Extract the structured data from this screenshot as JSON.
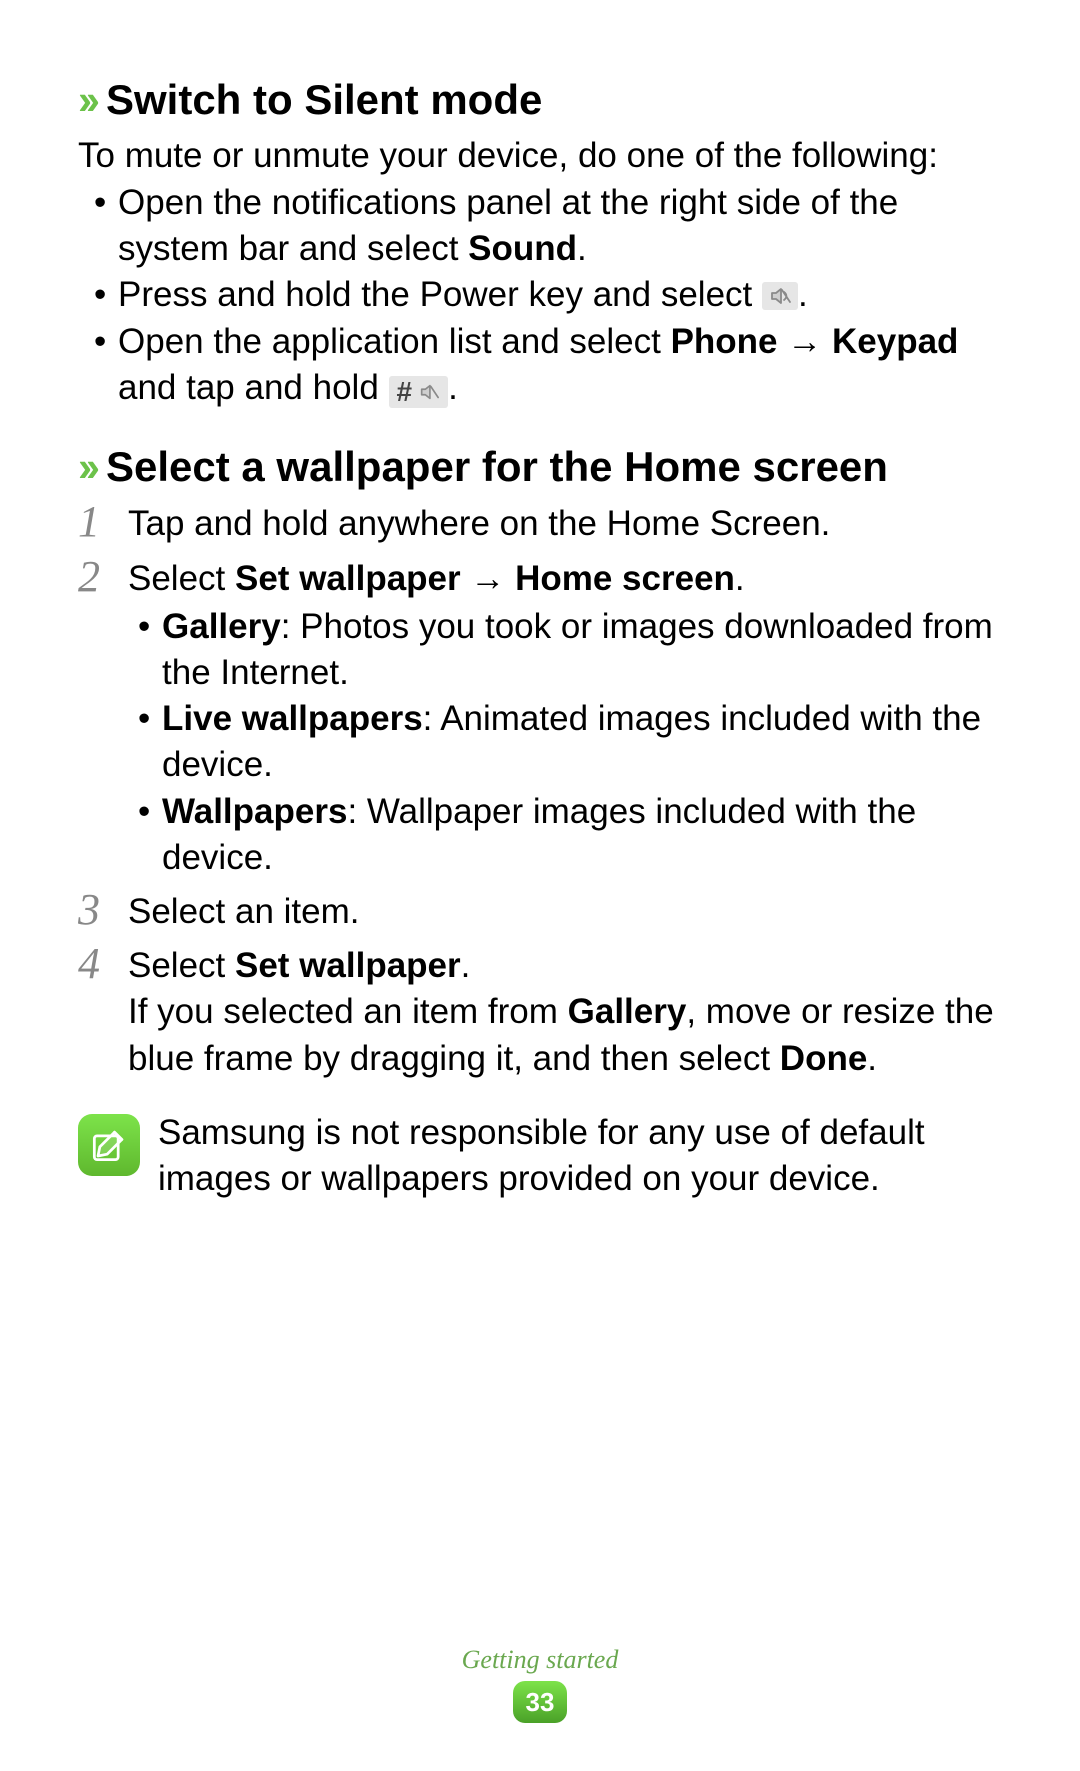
{
  "section1": {
    "title": "Switch to Silent mode",
    "intro": "To mute or unmute your device, do one of the following:",
    "bullets": {
      "b1_pre": "Open the notifications panel at the right side of the system bar and select ",
      "b1_bold": "Sound",
      "b1_post": ".",
      "b2": "Press and hold the Power key and select ",
      "b2_post": ".",
      "b3_pre": "Open the application list and select ",
      "b3_bold1": "Phone",
      "b3_arrow": " → ",
      "b3_bold2": "Keypad",
      "b3_mid": " and tap and hold ",
      "b3_post": "."
    }
  },
  "section2": {
    "title": "Select a wallpaper for the Home screen",
    "steps": {
      "s1": "Tap and hold anywhere on the Home Screen.",
      "s2_pre": "Select ",
      "s2_bold1": "Set wallpaper",
      "s2_arrow": " → ",
      "s2_bold2": "Home screen",
      "s2_post": ".",
      "s2_sub": {
        "a_bold": "Gallery",
        "a_rest": ": Photos you took or images downloaded from the Internet.",
        "b_bold": "Live wallpapers",
        "b_rest": ": Animated images included with the device.",
        "c_bold": "Wallpapers",
        "c_rest": ": Wallpaper images included with the device."
      },
      "s3": "Select an item.",
      "s4_pre": "Select ",
      "s4_bold": "Set wallpaper",
      "s4_post": ".",
      "s4_cont_pre": "If you selected an item from ",
      "s4_cont_bold1": "Gallery",
      "s4_cont_mid": ", move or resize the blue frame by dragging it, and then select ",
      "s4_cont_bold2": "Done",
      "s4_cont_post": "."
    },
    "note": "Samsung is not responsible for any use of default images or wallpapers provided on your device."
  },
  "footer": {
    "section": "Getting started",
    "page": "33"
  },
  "nums": {
    "n1": "1",
    "n2": "2",
    "n3": "3",
    "n4": "4"
  }
}
